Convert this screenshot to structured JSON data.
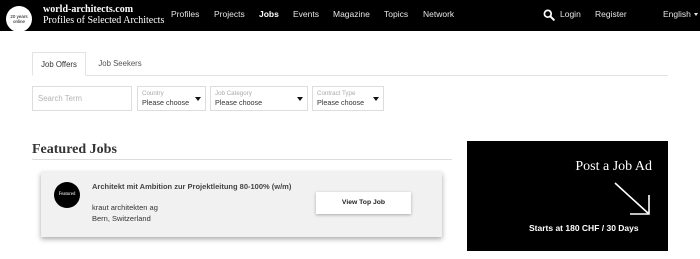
{
  "header": {
    "badge_line1": "20 years",
    "badge_line2": "online",
    "brand_name": "world-architects.com",
    "brand_tagline": "Profiles of Selected Architects",
    "nav": [
      "Profiles",
      "Projects",
      "Jobs",
      "Events",
      "Magazine",
      "Topics",
      "Network"
    ],
    "active_nav": "Jobs",
    "search_icon": "search-icon",
    "login_label": "Login",
    "register_label": "Register",
    "language_label": "English"
  },
  "tabs": {
    "offers_label": "Job Offers",
    "seekers_label": "Job Seekers",
    "active": "Job Offers"
  },
  "filters": {
    "search_placeholder": "Search Term",
    "country_label": "Country",
    "country_value": "Please choose",
    "category_label": "Job Category",
    "category_value": "Please choose",
    "contract_label": "Contract Type",
    "contract_value": "Please choose"
  },
  "featured": {
    "heading": "Featured Jobs",
    "job": {
      "badge": "Featured",
      "title": "Architekt mit Ambition zur Projektleitung 80-100% (w/m)",
      "company": "kraut architekten ag",
      "location": "Bern, Switzerland",
      "button_label": "View Top Job"
    }
  },
  "ad": {
    "title": "Post a Job Ad",
    "price": "Starts at 180 CHF / 30 Days",
    "icon": "arrow-down-right-icon"
  },
  "colors": {
    "header_bg": "#000000",
    "ad_bg": "#000000",
    "card_bg": "#f1f1f1"
  }
}
